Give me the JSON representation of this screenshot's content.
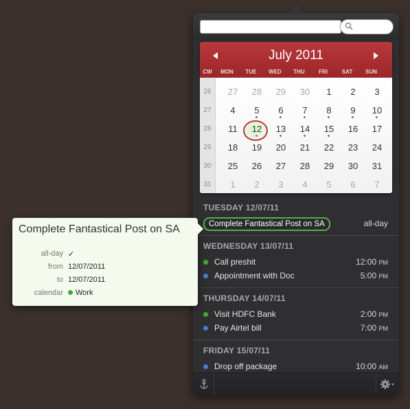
{
  "search": {
    "placeholder": "",
    "value": ""
  },
  "quick_entry": {
    "value": ""
  },
  "calendar": {
    "month_title": "July 2011",
    "cw_header": "CW",
    "weekdays": [
      "MON",
      "TUE",
      "WED",
      "THU",
      "FRI",
      "SAT",
      "SUN"
    ],
    "weeks": [
      {
        "cw": "26",
        "days": [
          {
            "d": "27",
            "other": true
          },
          {
            "d": "28",
            "other": true
          },
          {
            "d": "29",
            "other": true
          },
          {
            "d": "30",
            "other": true
          },
          {
            "d": "1"
          },
          {
            "d": "2"
          },
          {
            "d": "3"
          }
        ]
      },
      {
        "cw": "27",
        "days": [
          {
            "d": "4"
          },
          {
            "d": "5",
            "dot": true
          },
          {
            "d": "6",
            "dot": true
          },
          {
            "d": "7",
            "dot": true
          },
          {
            "d": "8",
            "dot": true
          },
          {
            "d": "9",
            "dot": true
          },
          {
            "d": "10",
            "dot": true
          }
        ]
      },
      {
        "cw": "28",
        "days": [
          {
            "d": "11"
          },
          {
            "d": "12",
            "dot": true,
            "today": true
          },
          {
            "d": "13",
            "dot": true
          },
          {
            "d": "14",
            "dot": true
          },
          {
            "d": "15",
            "dot": true
          },
          {
            "d": "16"
          },
          {
            "d": "17"
          }
        ]
      },
      {
        "cw": "29",
        "days": [
          {
            "d": "18"
          },
          {
            "d": "19"
          },
          {
            "d": "20"
          },
          {
            "d": "21"
          },
          {
            "d": "22"
          },
          {
            "d": "23"
          },
          {
            "d": "24"
          }
        ]
      },
      {
        "cw": "30",
        "days": [
          {
            "d": "25"
          },
          {
            "d": "26"
          },
          {
            "d": "27"
          },
          {
            "d": "28"
          },
          {
            "d": "29"
          },
          {
            "d": "30"
          },
          {
            "d": "31"
          }
        ]
      },
      {
        "cw": "31",
        "days": [
          {
            "d": "1",
            "other": true
          },
          {
            "d": "2",
            "other": true
          },
          {
            "d": "3",
            "other": true
          },
          {
            "d": "4",
            "other": true
          },
          {
            "d": "5",
            "other": true
          },
          {
            "d": "6",
            "other": true
          },
          {
            "d": "7",
            "other": true
          }
        ]
      }
    ]
  },
  "events": {
    "sections": [
      {
        "heading": "TUESDAY 12/07/11",
        "items": [
          {
            "title": "Complete Fantastical Post on SA",
            "time": "all-day",
            "highlight": true
          }
        ]
      },
      {
        "heading": "WEDNESDAY 13/07/11",
        "items": [
          {
            "title": "Call preshit",
            "time": "12:00",
            "ampm": "PM",
            "color": "#3fae2f"
          },
          {
            "title": "Appointment with Doc",
            "time": "5:00",
            "ampm": "PM",
            "color": "#3b82d6"
          }
        ]
      },
      {
        "heading": "THURSDAY 14/07/11",
        "items": [
          {
            "title": "Visit HDFC Bank",
            "time": "2:00",
            "ampm": "PM",
            "color": "#3fae2f"
          },
          {
            "title": "Pay Airtel bill",
            "time": "7:00",
            "ampm": "PM",
            "color": "#3b82d6"
          }
        ]
      },
      {
        "heading": "FRIDAY 15/07/11",
        "items": [
          {
            "title": "Drop off package",
            "time": "10:00",
            "ampm": "AM",
            "color": "#3b82d6"
          }
        ]
      }
    ]
  },
  "detail": {
    "title": "Complete Fantastical Post on SA",
    "allday_label": "all-day",
    "allday_value": "✓",
    "from_label": "from",
    "from_value": "12/07/2011",
    "to_label": "to",
    "to_value": "12/07/2011",
    "calendar_label": "calendar",
    "calendar_value": "Work",
    "calendar_color": "#3fae2f"
  },
  "icons": {
    "search": "search-icon",
    "anchor": "anchor-icon",
    "gear": "gear-icon",
    "prev": "chevron-left-icon",
    "next": "chevron-right-icon"
  }
}
